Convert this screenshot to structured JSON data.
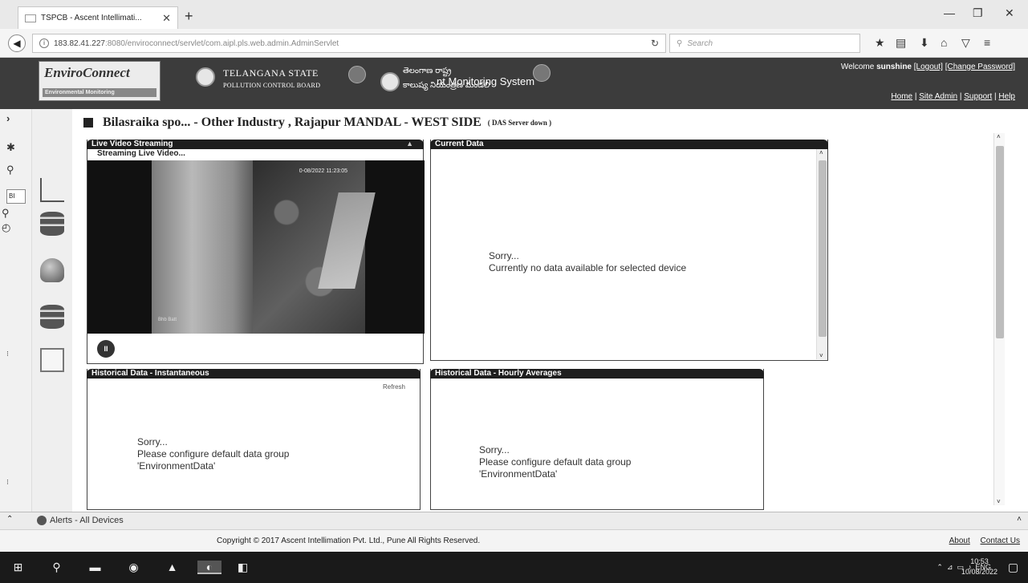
{
  "browser": {
    "tab_title": "TSPCB - Ascent Intellimati...",
    "url_host": "183.82.41.227",
    "url_path": ":8080/enviroconnect/servlet/com.aipl.pls.web.admin.AdminServlet",
    "search_placeholder": "Search"
  },
  "header": {
    "logo_main": "EnviroConnect",
    "logo_sub": "Environmental Monitoring",
    "board_line1": "TELANGANA STATE",
    "board_line2": "POLLUTION CONTROL BOARD",
    "regional_line1": "తెలంగాణ రాష్ట్ర",
    "regional_line2": "కాలుష్య నియంత్రణ మండలి",
    "system_title": "nt Monitoring System",
    "welcome_prefix": "Welcome",
    "username": "sunshine",
    "logout": "[Logout]",
    "change_password": "[Change Password]",
    "links": [
      "Home",
      "Site Admin",
      "Support",
      "Help"
    ]
  },
  "page": {
    "title": "Bilasraika spo... - Other Industry , Rajapur MANDAL - WEST SIDE",
    "status": "( DAS Server down )"
  },
  "panels": {
    "video": {
      "title": "Live Video Streaming",
      "subtitle": "Streaming Live Video...",
      "timestamp": "0-08/2022 11:23:05",
      "watermark": "Bhb Batt"
    },
    "current": {
      "title": "Current Data",
      "sorry": "Sorry...",
      "message": "Currently no data available for selected device"
    },
    "hist_inst": {
      "title": "Historical Data - Instantaneous",
      "refresh": "Refresh",
      "sorry": "Sorry...",
      "message_line1": "Please configure default data group",
      "message_line2": "'EnvironmentData'"
    },
    "hist_hourly": {
      "title": "Historical Data - Hourly Averages",
      "sorry": "Sorry...",
      "message_line1": "Please configure default data group",
      "message_line2": "'EnvironmentData'"
    }
  },
  "sidebar": {
    "mini_input_value": "BI"
  },
  "alerts": {
    "label": "Alerts - All Devices"
  },
  "footer": {
    "copyright": "Copyright © 2017 Ascent Intellimation Pvt. Ltd., Pune All Rights Reserved.",
    "about": "About",
    "contact": "Contact Us"
  },
  "taskbar": {
    "lang": "ENG",
    "time": "10:53",
    "date": "10/08/2022"
  }
}
